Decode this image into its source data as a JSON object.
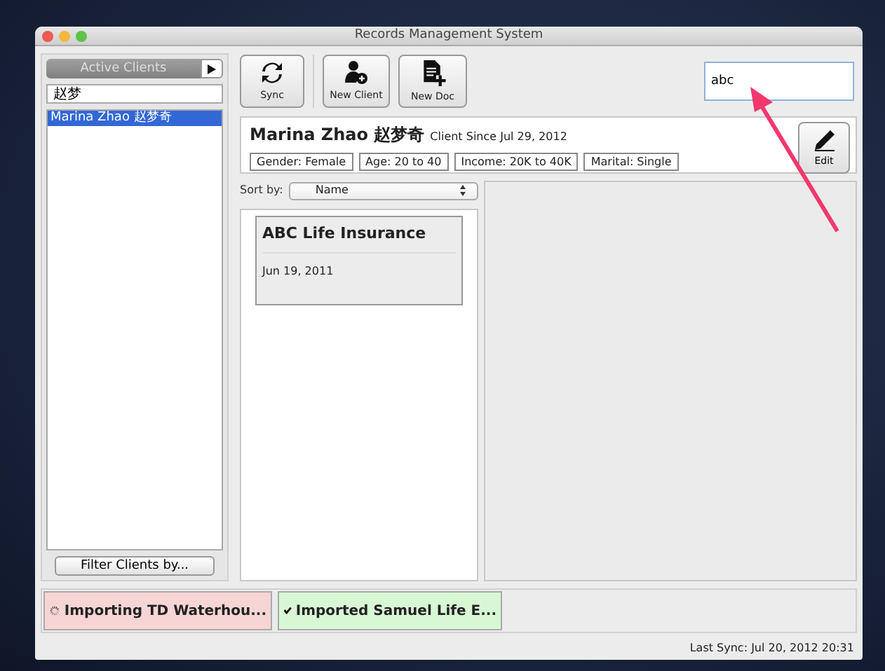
{
  "window": {
    "title": "Records Management System"
  },
  "sidebar": {
    "tab": "Active Clients",
    "search_value": "赵梦",
    "clients": [
      {
        "name": "Marina Zhao 赵梦奇",
        "selected": true
      }
    ],
    "filter_button": "Filter Clients by..."
  },
  "toolbar": {
    "buttons": [
      {
        "label": "Sync",
        "kind": "sync"
      },
      {
        "label": "New Client",
        "kind": "person"
      },
      {
        "label": "New Doc",
        "kind": "document"
      }
    ],
    "search_value": "abc"
  },
  "client": {
    "name": "Marina Zhao 赵梦奇",
    "since": "Client Since Jul 29, 2012",
    "tags": [
      "Gender: Female",
      "Age: 20 to 40",
      "Income: 20K to 40K",
      "Marital: Single"
    ],
    "edit_button": "Edit"
  },
  "sort": {
    "label": "Sort by:",
    "value": "Name"
  },
  "documents": [
    {
      "title": "ABC Life Insurance",
      "date": "Jun 19, 2011"
    }
  ],
  "tasks": [
    {
      "label": "Importing TD Waterhou...",
      "kind": "progress"
    },
    {
      "label": "Imported Samuel Life E...",
      "kind": "done"
    }
  ],
  "status_bar": "Last Sync: Jul 20, 2012 20:31"
}
